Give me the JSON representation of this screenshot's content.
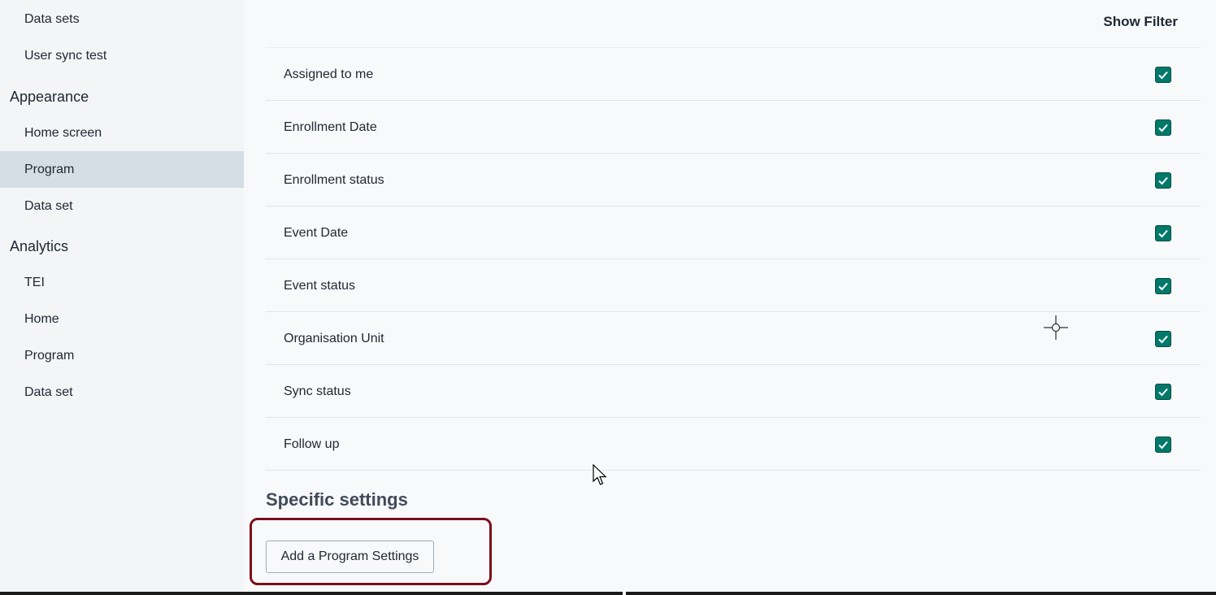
{
  "sidebar": {
    "items_top": [
      {
        "label": "Data sets"
      },
      {
        "label": "User sync test"
      }
    ],
    "appearance": {
      "title": "Appearance",
      "items": [
        {
          "label": "Home screen"
        },
        {
          "label": "Program"
        },
        {
          "label": "Data set"
        }
      ]
    },
    "analytics": {
      "title": "Analytics",
      "items": [
        {
          "label": "TEI"
        },
        {
          "label": "Home"
        },
        {
          "label": "Program"
        },
        {
          "label": "Data set"
        }
      ]
    }
  },
  "main": {
    "header_right": "Show Filter",
    "filters": [
      {
        "label": "Assigned to me",
        "checked": true
      },
      {
        "label": "Enrollment Date",
        "checked": true
      },
      {
        "label": "Enrollment status",
        "checked": true
      },
      {
        "label": "Event Date",
        "checked": true
      },
      {
        "label": "Event status",
        "checked": true
      },
      {
        "label": "Organisation Unit",
        "checked": true
      },
      {
        "label": "Sync status",
        "checked": true
      },
      {
        "label": "Follow up",
        "checked": true
      }
    ],
    "specific_settings_title": "Specific settings",
    "add_button_label": "Add a Program Settings"
  },
  "colors": {
    "checkbox": "#00796b",
    "active_item": "#d5dde5",
    "highlight": "#7b0e1d"
  }
}
